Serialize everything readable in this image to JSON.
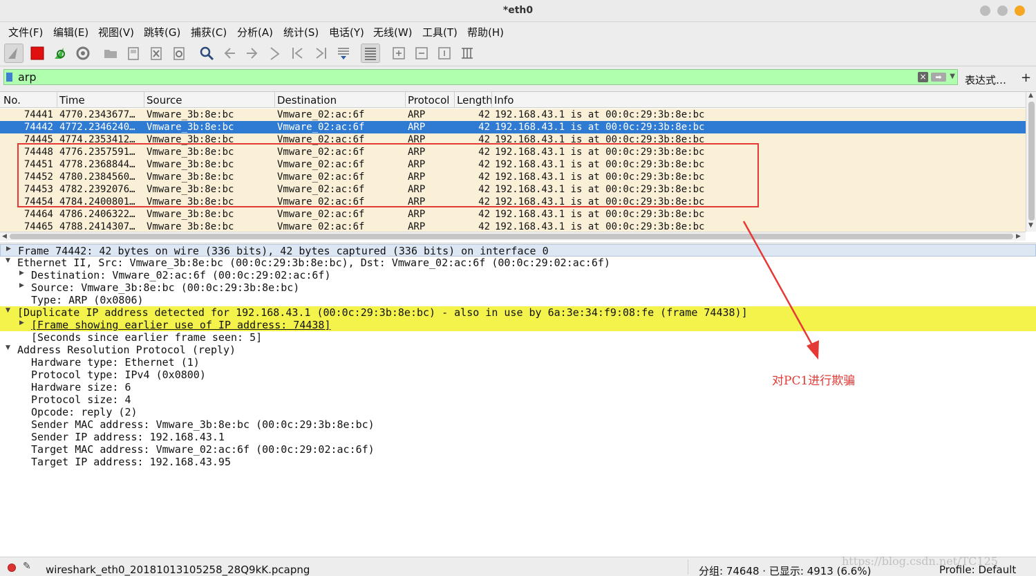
{
  "window": {
    "title": "*eth0",
    "buttons": [
      {
        "name": "minimize",
        "color": "#bdbdbd"
      },
      {
        "name": "maximize",
        "color": "#bdbdbd"
      },
      {
        "name": "close",
        "color": "#f5a623"
      }
    ]
  },
  "menu": [
    "文件(F)",
    "编辑(E)",
    "视图(V)",
    "跳转(G)",
    "捕获(C)",
    "分析(A)",
    "统计(S)",
    "电话(Y)",
    "无线(W)",
    "工具(T)",
    "帮助(H)"
  ],
  "toolbar": {
    "icons": [
      "shark-fin-start-icon",
      "stop-capture-icon",
      "restart-capture-icon",
      "capture-options-icon",
      "open-file-icon",
      "save-file-icon",
      "close-file-icon",
      "reload-file-icon",
      "find-packet-icon",
      "go-back-icon",
      "go-forward-icon",
      "go-to-packet-icon",
      "first-packet-icon",
      "last-packet-icon",
      "autoscroll-icon",
      "colorize-icon",
      "zoom-in-icon",
      "zoom-out-icon",
      "normal-size-icon",
      "resize-columns-icon"
    ]
  },
  "filter": {
    "value": "arp",
    "expression_label": "表达式…",
    "add_label": "+",
    "bg_color": "#afffaf"
  },
  "packet_list": {
    "columns": [
      "No.",
      "Time",
      "Source",
      "Destination",
      "Protocol",
      "Length",
      "Info"
    ],
    "rows": [
      {
        "no": "74441",
        "time": "4770.2343677…",
        "src": "Vmware_3b:8e:bc",
        "dst": "Vmware_02:ac:6f",
        "proto": "ARP",
        "len": "42",
        "info": "192.168.43.1 is at 00:0c:29:3b:8e:bc",
        "selected": false
      },
      {
        "no": "74442",
        "time": "4772.2346240…",
        "src": "Vmware_3b:8e:bc",
        "dst": "Vmware_02:ac:6f",
        "proto": "ARP",
        "len": "42",
        "info": "192.168.43.1 is at 00:0c:29:3b:8e:bc",
        "selected": true
      },
      {
        "no": "74445",
        "time": "4774.2353412…",
        "src": "Vmware_3b:8e:bc",
        "dst": "Vmware_02:ac:6f",
        "proto": "ARP",
        "len": "42",
        "info": "192.168.43.1 is at 00:0c:29:3b:8e:bc",
        "selected": false
      },
      {
        "no": "74448",
        "time": "4776.2357591…",
        "src": "Vmware_3b:8e:bc",
        "dst": "Vmware_02:ac:6f",
        "proto": "ARP",
        "len": "42",
        "info": "192.168.43.1 is at 00:0c:29:3b:8e:bc",
        "selected": false
      },
      {
        "no": "74451",
        "time": "4778.2368844…",
        "src": "Vmware_3b:8e:bc",
        "dst": "Vmware_02:ac:6f",
        "proto": "ARP",
        "len": "42",
        "info": "192.168.43.1 is at 00:0c:29:3b:8e:bc",
        "selected": false
      },
      {
        "no": "74452",
        "time": "4780.2384560…",
        "src": "Vmware_3b:8e:bc",
        "dst": "Vmware_02:ac:6f",
        "proto": "ARP",
        "len": "42",
        "info": "192.168.43.1 is at 00:0c:29:3b:8e:bc",
        "selected": false
      },
      {
        "no": "74453",
        "time": "4782.2392076…",
        "src": "Vmware_3b:8e:bc",
        "dst": "Vmware_02:ac:6f",
        "proto": "ARP",
        "len": "42",
        "info": "192.168.43.1 is at 00:0c:29:3b:8e:bc",
        "selected": false
      },
      {
        "no": "74454",
        "time": "4784.2400801…",
        "src": "Vmware_3b:8e:bc",
        "dst": "Vmware_02:ac:6f",
        "proto": "ARP",
        "len": "42",
        "info": "192.168.43.1 is at 00:0c:29:3b:8e:bc",
        "selected": false
      },
      {
        "no": "74464",
        "time": "4786.2406322…",
        "src": "Vmware_3b:8e:bc",
        "dst": "Vmware_02:ac:6f",
        "proto": "ARP",
        "len": "42",
        "info": "192.168.43.1 is at 00:0c:29:3b:8e:bc",
        "selected": false
      },
      {
        "no": "74465",
        "time": "4788.2414307…",
        "src": "Vmware_3b:8e:bc",
        "dst": "Vmware_02:ac:6f",
        "proto": "ARP",
        "len": "42",
        "info": "192.168.43.1 is at 00:0c:29:3b:8e:bc",
        "selected": false
      }
    ],
    "row_color": "#faf0d7",
    "selected_color": "#2f7bd3"
  },
  "details": [
    {
      "text": "Frame 74442: 42 bytes on wire (336 bits), 42 bytes captured (336 bits) on interface 0",
      "level": 0,
      "toggle": "collapsed",
      "style": "sel"
    },
    {
      "text": "Ethernet II, Src: Vmware_3b:8e:bc (00:0c:29:3b:8e:bc), Dst: Vmware_02:ac:6f (00:0c:29:02:ac:6f)",
      "level": 0,
      "toggle": "expanded",
      "style": ""
    },
    {
      "text": "Destination: Vmware_02:ac:6f (00:0c:29:02:ac:6f)",
      "level": 1,
      "toggle": "collapsed",
      "style": ""
    },
    {
      "text": "Source: Vmware_3b:8e:bc (00:0c:29:3b:8e:bc)",
      "level": 1,
      "toggle": "collapsed",
      "style": ""
    },
    {
      "text": "Type: ARP (0x0806)",
      "level": 1,
      "toggle": "none",
      "style": ""
    },
    {
      "text": "[Duplicate IP address detected for 192.168.43.1 (00:0c:29:3b:8e:bc) - also in use by 6a:3e:34:f9:08:fe (frame 74438)]",
      "level": 0,
      "toggle": "expanded",
      "style": "hl"
    },
    {
      "text": "[Frame showing earlier use of IP address: 74438]",
      "level": 1,
      "toggle": "collapsed",
      "style": "hl-link"
    },
    {
      "text": "[Seconds since earlier frame seen: 5]",
      "level": 1,
      "toggle": "none",
      "style": ""
    },
    {
      "text": "Address Resolution Protocol (reply)",
      "level": 0,
      "toggle": "expanded",
      "style": ""
    },
    {
      "text": "Hardware type: Ethernet (1)",
      "level": 1,
      "toggle": "none",
      "style": ""
    },
    {
      "text": "Protocol type: IPv4 (0x0800)",
      "level": 1,
      "toggle": "none",
      "style": ""
    },
    {
      "text": "Hardware size: 6",
      "level": 1,
      "toggle": "none",
      "style": ""
    },
    {
      "text": "Protocol size: 4",
      "level": 1,
      "toggle": "none",
      "style": ""
    },
    {
      "text": "Opcode: reply (2)",
      "level": 1,
      "toggle": "none",
      "style": ""
    },
    {
      "text": "Sender MAC address: Vmware_3b:8e:bc (00:0c:29:3b:8e:bc)",
      "level": 1,
      "toggle": "none",
      "style": ""
    },
    {
      "text": "Sender IP address: 192.168.43.1",
      "level": 1,
      "toggle": "none",
      "style": ""
    },
    {
      "text": "Target MAC address: Vmware_02:ac:6f (00:0c:29:02:ac:6f)",
      "level": 1,
      "toggle": "none",
      "style": ""
    },
    {
      "text": "Target IP address: 192.168.43.95",
      "level": 1,
      "toggle": "none",
      "style": ""
    }
  ],
  "annotation": {
    "text": "对PC1进行欺骗",
    "color": "#e53935"
  },
  "status": {
    "file": "wireshark_eth0_20181013105258_28Q9kK.pcapng",
    "counts": "分组: 74648 · 已显示: 4913 (6.6%)",
    "profile": "Profile: Default",
    "watermark": "https://blog.csdn.net/TC125"
  }
}
